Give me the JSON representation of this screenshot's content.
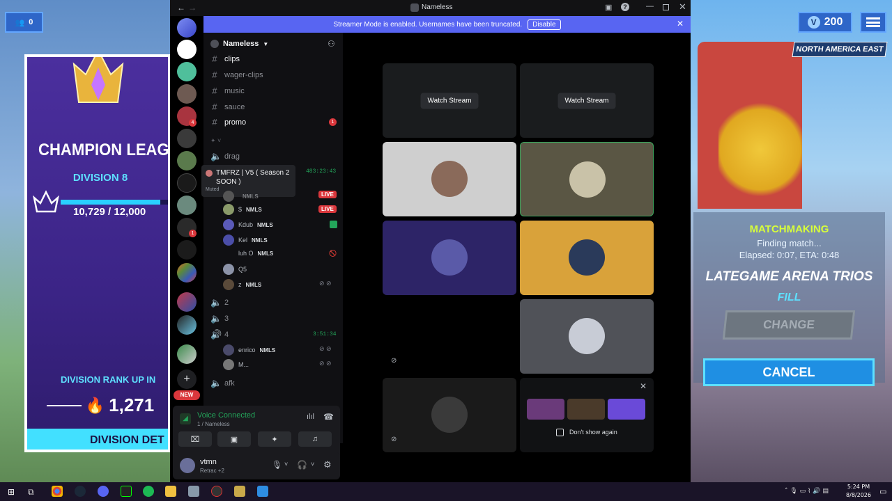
{
  "game": {
    "friends_count": "0",
    "vbucks": "200",
    "region": "NORTH AMERICA EAST",
    "card": {
      "title": "CHAMPION LEAG",
      "division": "DIVISION 8",
      "progress": "10,729 / 12,000",
      "progress_fraction": 0.894,
      "rank_up": "DIVISION RANK UP IN",
      "rank_value": "1,271",
      "details": "DIVISION DET"
    },
    "matchmaking": {
      "heading": "MATCHMAKING",
      "status": "Finding match...",
      "elapsed": "Elapsed: 0:07, ETA: 0:48",
      "mode": "LATEGAME ARENA TRIOS",
      "fill": "FILL",
      "change": "CHANGE",
      "cancel": "CANCEL"
    }
  },
  "discord": {
    "window_title": "Nameless",
    "banner_text": "Streamer Mode is enabled. Usernames have been truncated.",
    "banner_button": "Disable",
    "server_name": "Nameless",
    "channels": [
      {
        "name": "clips",
        "bold": true
      },
      {
        "name": "wager-clips"
      },
      {
        "name": "music"
      },
      {
        "name": "sauce"
      },
      {
        "name": "promo",
        "bold": true,
        "badge": "1"
      }
    ],
    "voice_drag": "drag",
    "tooltip_title": "TMFRZ | V5 ( Season 2 SOON )",
    "tooltip_timer": "483:23:43",
    "tooltip_muted": "Muted",
    "live_label": "LIVE",
    "voice_users": [
      {
        "name": "",
        "tag": "NMLS",
        "live": true
      },
      {
        "name": "$",
        "tag": "NMLS",
        "live": true
      },
      {
        "name": "Kdub",
        "tag": "NMLS"
      },
      {
        "name": "Kel",
        "tag": "NMLS"
      },
      {
        "name": "luh O",
        "tag": "NMLS"
      },
      {
        "name": "Q5",
        "tag": ""
      },
      {
        "name": "z",
        "tag": "NMLS"
      }
    ],
    "voice_channels": [
      "2",
      "3",
      "4"
    ],
    "vc4_timer": "3:51:34",
    "vc4_users": [
      {
        "name": "enrico",
        "tag": "NMLS"
      },
      {
        "name": "M...",
        "tag": ""
      }
    ],
    "afk": "afk",
    "new_badge": "NEW",
    "watch_stream": "Watch Stream",
    "dont_show_again": "Don't show again",
    "voice_connected": "Voice Connected",
    "voice_sub": "1 / Nameless",
    "user": {
      "name": "vtmn",
      "status": "Retrac +2"
    },
    "server_badges": [
      "4",
      "1"
    ]
  },
  "taskbar": {
    "time": "5:24 PM",
    "date": "8/8/2026"
  }
}
